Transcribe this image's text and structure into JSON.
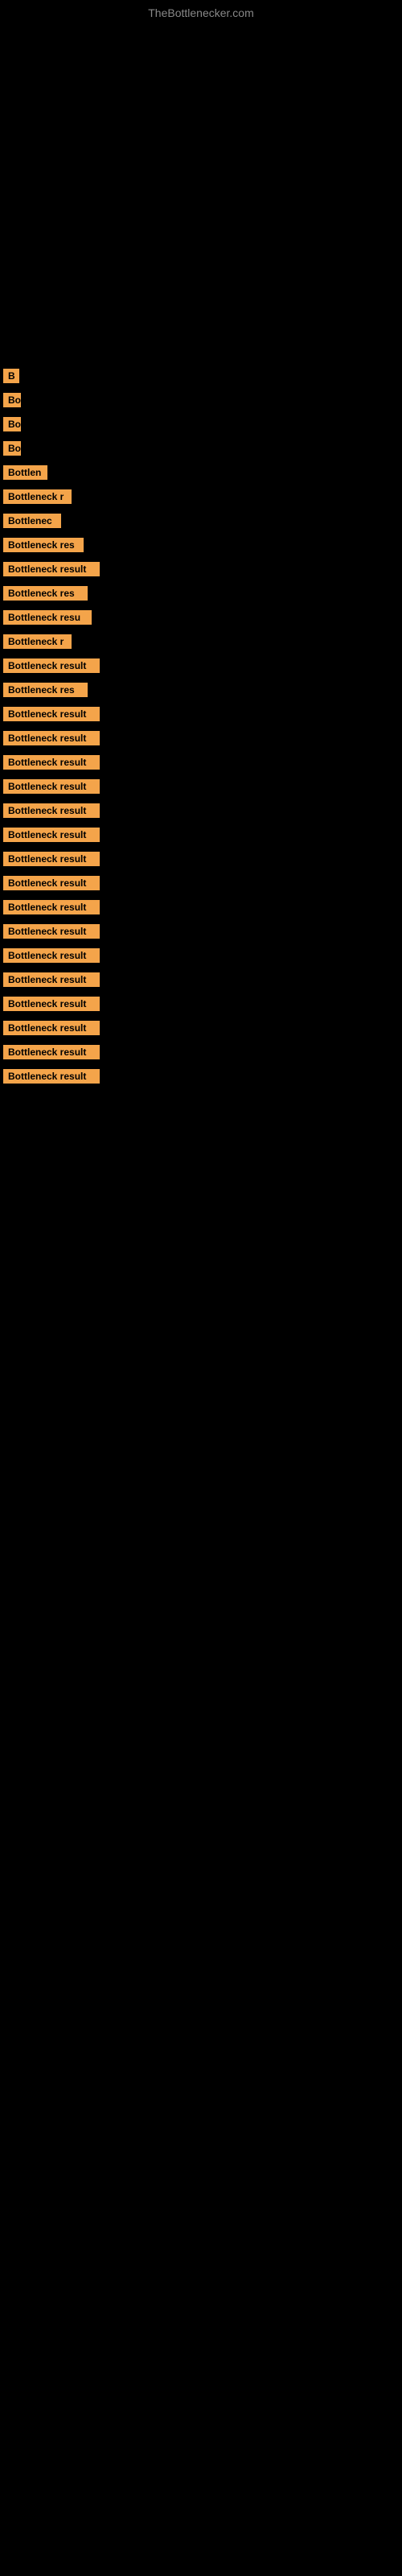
{
  "site": {
    "title": "TheBottlenecker.com"
  },
  "results": [
    {
      "id": 1,
      "label": "B",
      "width": 20
    },
    {
      "id": 2,
      "label": "Bo",
      "width": 22
    },
    {
      "id": 3,
      "label": "Bo",
      "width": 22
    },
    {
      "id": 4,
      "label": "Bo",
      "width": 22
    },
    {
      "id": 5,
      "label": "Bottlen",
      "width": 55
    },
    {
      "id": 6,
      "label": "Bottleneck r",
      "width": 85
    },
    {
      "id": 7,
      "label": "Bottlenec",
      "width": 72
    },
    {
      "id": 8,
      "label": "Bottleneck res",
      "width": 100
    },
    {
      "id": 9,
      "label": "Bottleneck result",
      "width": 120
    },
    {
      "id": 10,
      "label": "Bottleneck res",
      "width": 105
    },
    {
      "id": 11,
      "label": "Bottleneck resu",
      "width": 110
    },
    {
      "id": 12,
      "label": "Bottleneck r",
      "width": 85
    },
    {
      "id": 13,
      "label": "Bottleneck result",
      "width": 120
    },
    {
      "id": 14,
      "label": "Bottleneck res",
      "width": 105
    },
    {
      "id": 15,
      "label": "Bottleneck result",
      "width": 120
    },
    {
      "id": 16,
      "label": "Bottleneck result",
      "width": 120
    },
    {
      "id": 17,
      "label": "Bottleneck result",
      "width": 120
    },
    {
      "id": 18,
      "label": "Bottleneck result",
      "width": 120
    },
    {
      "id": 19,
      "label": "Bottleneck result",
      "width": 120
    },
    {
      "id": 20,
      "label": "Bottleneck result",
      "width": 120
    },
    {
      "id": 21,
      "label": "Bottleneck result",
      "width": 120
    },
    {
      "id": 22,
      "label": "Bottleneck result",
      "width": 120
    },
    {
      "id": 23,
      "label": "Bottleneck result",
      "width": 120
    },
    {
      "id": 24,
      "label": "Bottleneck result",
      "width": 120
    },
    {
      "id": 25,
      "label": "Bottleneck result",
      "width": 120
    },
    {
      "id": 26,
      "label": "Bottleneck result",
      "width": 120
    },
    {
      "id": 27,
      "label": "Bottleneck result",
      "width": 120
    },
    {
      "id": 28,
      "label": "Bottleneck result",
      "width": 120
    },
    {
      "id": 29,
      "label": "Bottleneck result",
      "width": 120
    },
    {
      "id": 30,
      "label": "Bottleneck result",
      "width": 120
    }
  ]
}
